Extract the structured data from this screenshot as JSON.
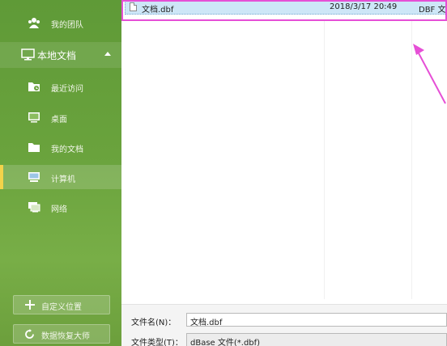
{
  "sidebar": {
    "team_label": "我的团队",
    "local_docs_label": "本地文档",
    "items": [
      {
        "label": "最近访问",
        "icon": "recent-folder-icon"
      },
      {
        "label": "桌面",
        "icon": "desktop-icon"
      },
      {
        "label": "我的文档",
        "icon": "folder-icon"
      },
      {
        "label": "计算机",
        "icon": "computer-icon"
      },
      {
        "label": "网络",
        "icon": "network-icon"
      }
    ],
    "custom_location_label": "自定义位置",
    "data_recovery_label": "数据恢复大师"
  },
  "file_list": {
    "rows": [
      {
        "name": "文档.dbf",
        "modified": "2018/3/17 20:49",
        "type": "DBF 文件"
      }
    ]
  },
  "bottom": {
    "filename_label": "文件名(N)：",
    "filename_value": "文档.dbf",
    "filetype_label": "文件类型(T)：",
    "filetype_value": "dBase 文件(*.dbf)"
  },
  "colors": {
    "sidebar_green": "#6aa33d",
    "active_marker": "#f3d34a",
    "selection": "#cde6f7",
    "annotation": "#e64fd6"
  }
}
